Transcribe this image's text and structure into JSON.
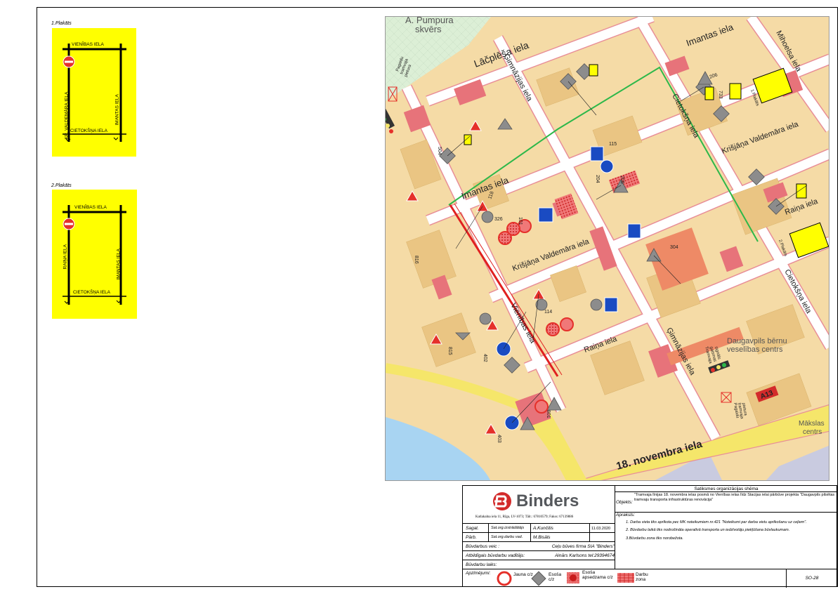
{
  "plakats": [
    {
      "title": "1.Plakāts",
      "top_street": "VIENĪBAS IELA",
      "left_street": "KR. VALDEMĀRA IELA",
      "right_street": "IMANTAS IELA",
      "bottom_street": "CIETOKŠŅA IELA"
    },
    {
      "title": "2.Plakāts",
      "top_street": "VIENĪBAS IELA",
      "left_street": "RAIŅA IELA",
      "right_street": "IMANTAS IELA",
      "bottom_street": "CIETOKŠŅA IELA"
    }
  ],
  "map": {
    "streets": {
      "lacplesa": "Lāčplēša iela",
      "imantas_top": "Imantas iela",
      "imantas_mid": "Imantas iela",
      "gimnazijas_top": "Ģimnāzijas iela",
      "gimnazijas_bottom": "Ģimnāzijas iela",
      "cietoksna_top": "Cietokšņa iela",
      "cietoksna_bottom": "Cietokšņa iela",
      "valdemara_left": "Krišjāņa Valdemāra iela",
      "valdemara_right": "Krišjāņa Valdemāra iela",
      "vienibas": "Vienības iela",
      "raina_left": "Raiņa iela",
      "raina_right": "Raiņa iela",
      "novembra": "18. novembra iela",
      "mihoelsa": "Mihoelsa iela"
    },
    "places": {
      "skvers_line1": "A. Pumpura",
      "skvers_line2": "skvērs",
      "clinic_line1": "Daugavpils bērnu",
      "clinic_line2": "veselības centrs",
      "art_line1": "Mākslas",
      "art_line2": "centrs"
    },
    "road_badge": "A13",
    "sign_labels": [
      "118",
      "326",
      "101",
      "204",
      "205",
      "402",
      "403",
      "801",
      "815",
      "816",
      "206",
      "733",
      "115",
      "114",
      "504",
      "304"
    ],
    "signal_labels": [
      "Tramvaja",
      "gaismas",
      "signāls"
    ],
    "plakats_labels": [
      "1.Plakāts",
      "2.Plakāts"
    ],
    "stop_labels": [
      "Pagaidu",
      "tramvaja",
      "pietura"
    ]
  },
  "titleblock": {
    "logo_text": "Binders",
    "address": "Katlakalna iela 11, Rīga, LV-1073; Tālr.: 67810579; Fakss: 67139886",
    "sheet_title": "Satiksmes organizācijas shēma",
    "objekts_label": "Objekts:",
    "objekts_text": "\"Tramvaja līnijas 18. novembra ielas posmā no Vienības ielas līdz Stacijas ielai pārbūve projekta \"Daugavpils pilsētas tramvaju transporta infrastruktūras renovācija\"",
    "apraksts_label": "Apraksts:",
    "apraksts_lines": [
      "1. Darba vieta tiks aprīkota pec MK noteikumiem nr.421 \"Noteikumi par darba vietu aprīkošanu uz ceļiem\".",
      "2. Būvdarbu laikā tiks nodrošināta operatīvā transporta un iedzīvotāju piekļūšana būvlaukumam.",
      "3.Būvdarbu zona tiks norobežota."
    ],
    "saget_label": "Sagat.",
    "saget_role": "Sat.org.izstrādātājs",
    "saget_name": "A.Kunčitis",
    "saget_date": "11.03.2020",
    "parb_label": "Pārb.",
    "parb_role": "Sat.org.darbu vad.",
    "parb_name": "M.Bisāls",
    "veic_label": "Būvdarbus veic :",
    "veic_value": "Ceļu būves firma SIA \"Binders\"",
    "vaditajs_label": "Atbildīgais būvdarbu vadītājs:",
    "vaditajs_value": "Ainārs Karlsons tel:29394674",
    "laiks_label": "Būvdarbu laiks:",
    "apz_label": "Apzīmējumi:",
    "legend": [
      {
        "label": "Jauna c/z"
      },
      {
        "label": "Esoša c/z"
      },
      {
        "label": "Esoša apsedzama c/z"
      },
      {
        "label": "Darbu zona"
      }
    ],
    "sheet_no": "SO-28"
  },
  "colors": {
    "plakats_bg": "#ffff00",
    "map_block": "#f5dba6",
    "map_building": "#eac583",
    "map_highlight": "#e7737a",
    "map_road": "#ffffff",
    "road_outline": "#e88e97",
    "main_road": "#f5e66a",
    "water": "#a8d4f2",
    "park": "#d9efd4",
    "tram_line": "#2db84a",
    "work_zone": "#e02020",
    "logo_red": "#d32b2b",
    "logo_grey": "#55585c"
  }
}
